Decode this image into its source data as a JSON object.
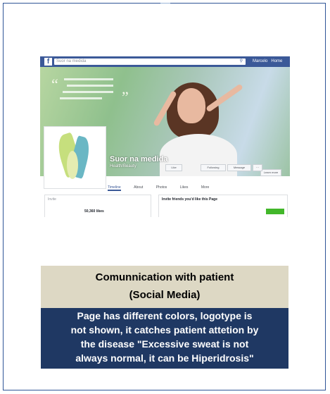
{
  "screenshot": {
    "search_text": "Suor na medida",
    "user_label": "Marcelo",
    "home_label": "Home",
    "page_name": "Suor na medida",
    "page_category": "Health/Beauty",
    "cover_button": "Learn more",
    "tabs": [
      "Timeline",
      "About",
      "Photos",
      "Likes",
      "More"
    ],
    "like_button": "Like",
    "follow_button": "Following",
    "message_button": "Message",
    "about_title": "Invite",
    "likes_count": "50,360 likes",
    "invite_text": "Invite friends you'd like this Page"
  },
  "caption": {
    "title_line1": "Comunnication with patient",
    "title_line2": "(Social Media)",
    "desc_lines": [
      "Page has different colors, logotype is",
      "not shown, it catches patient attetion by",
      "the disease \"Excessive sweat is not",
      "always normal, it can be Hiperidrosis\""
    ]
  },
  "colors": {
    "frame_border": "#2f5597",
    "title_bg": "#ddd8c4",
    "desc_bg": "#1f3863",
    "facebook_blue": "#3b5998"
  }
}
